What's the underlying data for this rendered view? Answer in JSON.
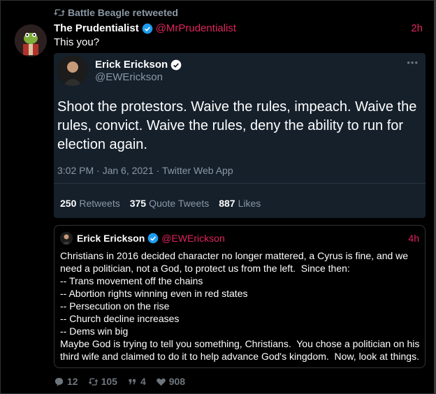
{
  "retweet_by": "Battle Beagle retweeted",
  "tweet": {
    "author_name": "The Prudentialist",
    "author_handle": "@MrPrudentialist",
    "time": "2h",
    "text": "This you?"
  },
  "embedded": {
    "author_name": "Erick Erickson",
    "author_handle": "@EWErickson",
    "text": "Shoot the protestors.  Waive the rules, impeach.  Waive the rules, convict.  Waive the rules, deny the ability to run for election again.",
    "meta": "3:02 PM · Jan 6, 2021 · Twitter Web App",
    "retweets_count": "250",
    "retweets_label": "Retweets",
    "quotes_count": "375",
    "quotes_label": "Quote Tweets",
    "likes_count": "887",
    "likes_label": "Likes"
  },
  "quoted": {
    "author_name": "Erick Erickson",
    "author_handle": "@EWErickson",
    "time": "4h",
    "lines": [
      "Christians in 2016 decided character no longer mattered, a Cyrus is fine, and we need a politician, not a God, to protect us from the left.  Since then:",
      "-- Trans movement off the chains",
      "-- Abortion rights winning even in red states",
      "-- Persecution on the rise",
      "-- Church decline increases",
      "-- Dems win big",
      "Maybe God is trying to tell you something, Christians.  You chose a politician on his third wife and claimed to do it to help advance God's kingdom.  Now, look at things."
    ]
  },
  "actions": {
    "replies": "12",
    "retweets": "105",
    "quotes": "4",
    "likes": "908"
  },
  "colors": {
    "accent": "#e0245e",
    "verified": "#1d9bf0",
    "embed_bg": "#15202b"
  }
}
